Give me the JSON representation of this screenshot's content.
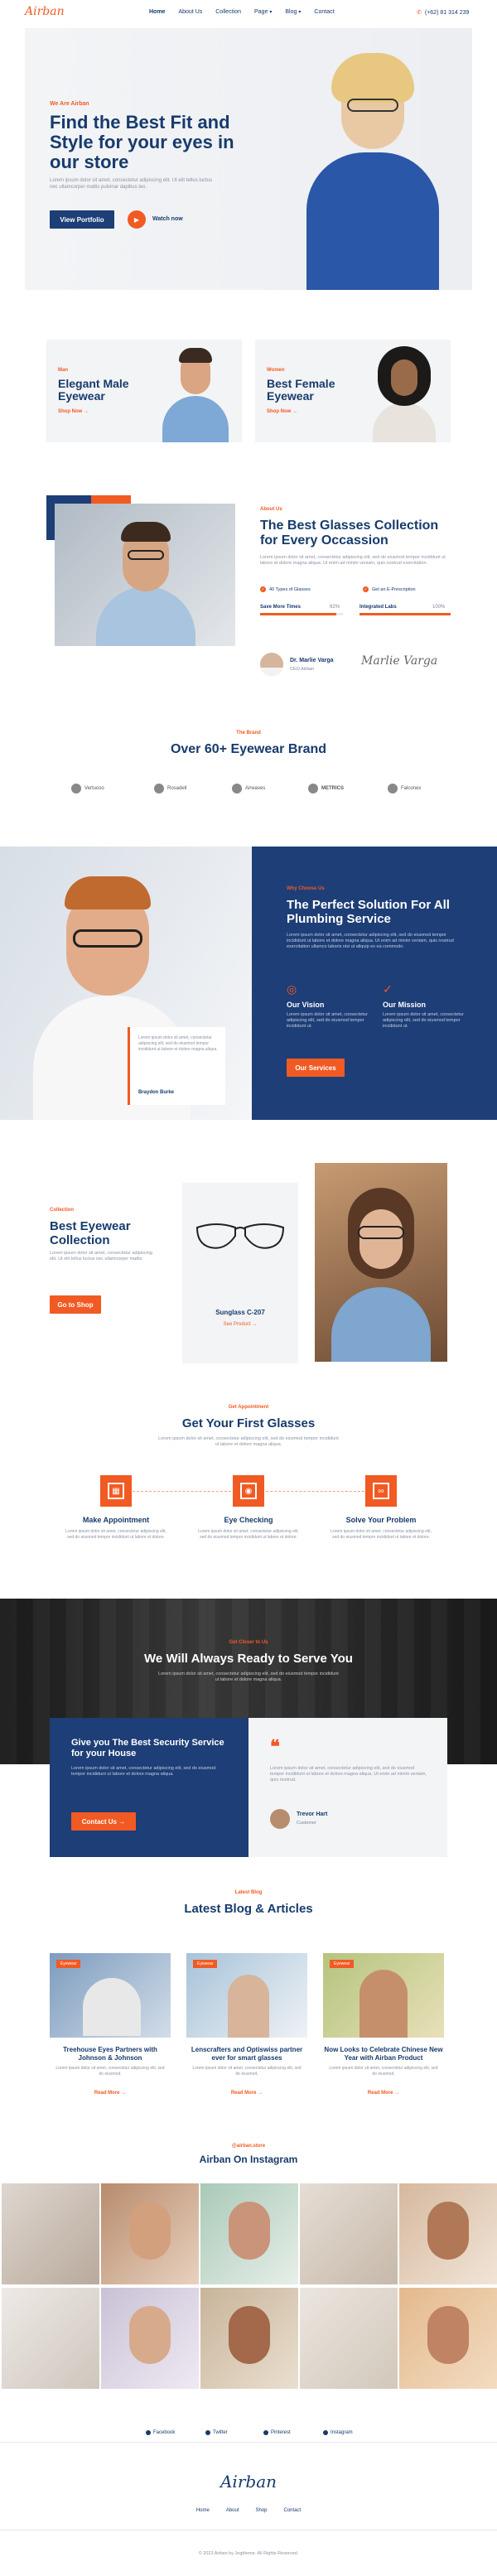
{
  "header": {
    "logo": "Airban",
    "nav": [
      "Home",
      "About Us",
      "Collection",
      "Page",
      "Blog",
      "Contact"
    ],
    "phone": "(+62) 81 314 239"
  },
  "hero": {
    "kicker": "We Are Airban",
    "title": "Find the Best Fit and Style for your eyes in our store",
    "desc": "Lorem ipsum dolor sit amet, consectetur adipiscing elit. Ut elit tellus luctus nec ullamcorper mattis pulvinar dapibus leo.",
    "btn": "View Portfolio",
    "watch": "Watch now"
  },
  "promo": [
    {
      "kicker": "Man",
      "title": "Elegant Male Eyewear",
      "link": "Shop Now →"
    },
    {
      "kicker": "Women",
      "title": "Best Female Eyewear",
      "link": "Shop Now →"
    }
  ],
  "about": {
    "kicker": "About Us",
    "title": "The Best Glasses Collection for Every Occassion",
    "desc": "Lorem ipsum dolor sit amet, consectetur adipiscing elit, sed do eiusmod tempor incididunt ut labore et dolore magna aliqua. Ut enim ad minim veniam, quis nostrud exercitation.",
    "f1": "40 Types of Glasses",
    "f2": "Get an E-Prescription",
    "bar1": "Save More Times",
    "bar1_pct": "92%",
    "bar2": "Integrated Labs",
    "bar2_pct": "100%",
    "bar1_val": 0.92,
    "bar2_val": 1.0,
    "person": "Dr. Marlie Varga",
    "role": "CEO Airban"
  },
  "brands": {
    "kicker": "The Brand",
    "title": "Over 60+ Eyewear Brand",
    "items": [
      "Vertuoso",
      "Rosadell",
      "Airwaves",
      "METRICS",
      "Falconex"
    ]
  },
  "why": {
    "kicker": "Why Choose Us",
    "title": "The Perfect Solution For All Plumbing Service",
    "desc": "Lorem ipsum dolor sit amet, consectetur adipiscing elit, sed do eiusmod tempor incididunt ut labore et dolore magna aliqua. Ut enim ad minim veniam, quis nostrud exercitation ullamco laboris nisi ut aliquip ex ea commodo.",
    "vision": "Our Vision",
    "mission": "Our Mission",
    "vdesc": "Lorem ipsum dolor sit amet, consectetur adipiscing elit, sed do eiusmod tempor incididunt ut.",
    "mdesc": "Lorem ipsum dolor sit amet, consectetur adipiscing elit, sed do eiusmod tempor incididunt ut.",
    "btn": "Our Services",
    "quote": "Lorem ipsum dolor sit amet, consectetur adipiscing elit, sed do eiusmod tempor incididunt ut labore et dolore magna aliqua.",
    "quote_name": "Braydon Burke"
  },
  "collection": {
    "kicker": "Collection",
    "title": "Best Eyewear Collection",
    "desc": "Lorem ipsum dolor sit amet, consectetur adipiscing elit. Ut elit tellus luctus nec ullamcorper mattis.",
    "btn": "Go to Shop",
    "product": "Sunglass C-207",
    "link": "See Product →"
  },
  "appointment": {
    "kicker": "Get Appointment",
    "title": "Get Your First Glasses",
    "desc": "Lorem ipsum dolor sit amet, consectetur adipiscing elit, sed do eiusmod tempor incididunt ut labore et dolore magna aliqua.",
    "steps": [
      {
        "title": "Make Appointment",
        "desc": "Lorem ipsum dolor sit amet, consectetur adipiscing elit, sed do eiusmod tempor incididunt ut labore et dolore."
      },
      {
        "title": "Eye Checking",
        "desc": "Lorem ipsum dolor sit amet, consectetur adipiscing elit, sed do eiusmod tempor incididunt ut labore et dolore."
      },
      {
        "title": "Solve Your Problem",
        "desc": "Lorem ipsum dolor sit amet, consectetur adipiscing elit, sed do eiusmod tempor incididunt ut labore et dolore."
      }
    ]
  },
  "ready": {
    "kicker": "Get Closer to Us",
    "title": "We Will Always Ready to Serve You",
    "desc": "Lorem ipsum dolor sit amet, consectetur adipiscing elit, sed do eiusmod tempor incididunt ut labore et dolore magna aliqua."
  },
  "contact": {
    "title": "Give you The Best Security Service for your House",
    "desc": "Lorem ipsum dolor sit amet, consectetur adipiscing elit, sed do eiusmod tempor incididunt ut labore et dolore magna aliqua.",
    "btn": "Contact Us →",
    "quote": "Lorem ipsum dolor sit amet, consectetur adipiscing elit, sed do eiusmod tempor incididunt ut labore et dolore magna aliqua. Ut enim ad minim veniam, quis nostrud.",
    "name": "Trevor Hart",
    "role": "Customer"
  },
  "blog": {
    "kicker": "Latest Blog",
    "title": "Latest Blog & Articles",
    "posts": [
      {
        "tag": "Eyewear",
        "title": "Treehouse Eyes Partners with Johnson & Johnson",
        "desc": "Lorem ipsum dolor sit amet, consectetur adipiscing elit, sed do eiusmod.",
        "link": "Read More →"
      },
      {
        "tag": "Eyewear",
        "title": "Lenscrafters and Optiswiss partner ever for smart glasses",
        "desc": "Lorem ipsum dolor sit amet, consectetur adipiscing elit, sed do eiusmod.",
        "link": "Read More →"
      },
      {
        "tag": "Eyewear",
        "title": "Now Looks to Celebrate Chinese New Year with Airban Product",
        "desc": "Lorem ipsum dolor sit amet, consectetur adipiscing elit, sed do eiusmod.",
        "link": "Read More →"
      }
    ]
  },
  "instagram": {
    "kicker": "@airban.store",
    "title": "Airban On Instagram"
  },
  "footer": {
    "social": [
      "Facebook",
      "Twitter",
      "Pinterest",
      "Instagram"
    ],
    "logo": "Airban",
    "nav": [
      "Home",
      "About",
      "Shop",
      "Contact"
    ],
    "copy": "© 2023 Airban by Jegtheme. All Rights Reserved."
  }
}
